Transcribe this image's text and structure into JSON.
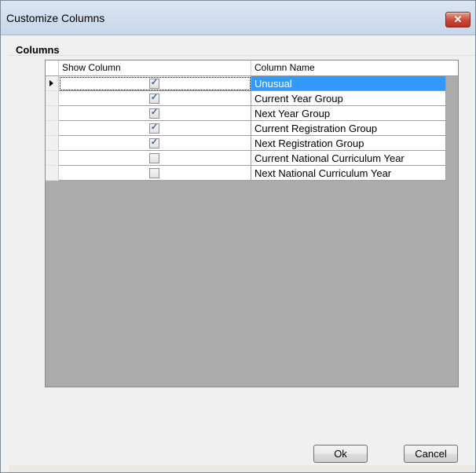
{
  "window": {
    "title": "Customize Columns",
    "close_label": "✕"
  },
  "group": {
    "label": "Columns"
  },
  "grid": {
    "headers": [
      "Show Column",
      "Column Name"
    ],
    "rows": [
      {
        "checked": true,
        "name": "Unusual"
      },
      {
        "checked": true,
        "name": "Current Year Group"
      },
      {
        "checked": true,
        "name": "Next Year Group"
      },
      {
        "checked": true,
        "name": "Current Registration Group"
      },
      {
        "checked": true,
        "name": "Next Registration Group"
      },
      {
        "checked": false,
        "name": "Current National Curriculum Year"
      },
      {
        "checked": false,
        "name": "Next National Curriculum Year"
      }
    ],
    "selected_row": 0
  },
  "buttons": {
    "ok": "Ok",
    "cancel": "Cancel"
  },
  "colors": {
    "selection": "#3399ff",
    "grid_background": "#ababab"
  }
}
